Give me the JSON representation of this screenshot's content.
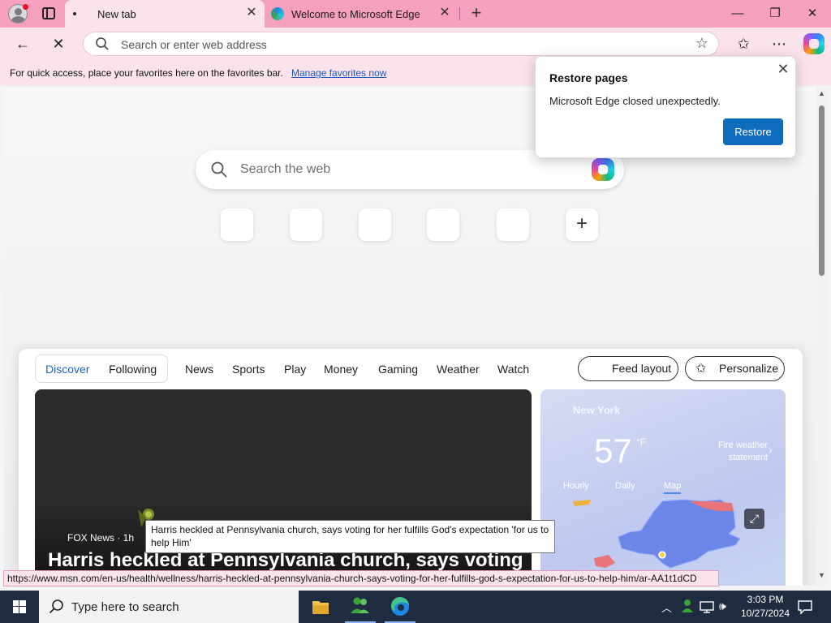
{
  "browser": {
    "tabs": [
      {
        "title": "New tab",
        "active": true
      },
      {
        "title": "Welcome to Microsoft Edge",
        "active": false
      }
    ],
    "address_placeholder": "Search or enter web address",
    "favorites_bar": {
      "message": "For quick access, place your favorites here on the favorites bar.",
      "link": "Manage favorites now"
    },
    "window_controls": {
      "minimize": "—",
      "restore": "❐",
      "close": "✕"
    }
  },
  "ntp": {
    "search_placeholder": "Search the web",
    "quick_links_count": 5,
    "add_link": "+"
  },
  "feed": {
    "pivots": {
      "discover": "Discover",
      "following": "Following"
    },
    "nav": [
      "News",
      "Sports",
      "Play",
      "Money",
      "Gaming",
      "Weather",
      "Watch"
    ],
    "feed_layout": "Feed layout",
    "personalize": "Personalize",
    "hero": {
      "source": "FOX News · 1h",
      "headline": "Harris heckled at Pennsylvania church, says voting"
    },
    "weather": {
      "city": "New York",
      "temp": "57",
      "unit": "°F",
      "alert": "Fire weather statement",
      "tabs": [
        "Hourly",
        "Daily",
        "Map"
      ],
      "selected_tab": "Map"
    }
  },
  "dialog": {
    "title": "Restore pages",
    "message": "Microsoft Edge closed unexpectedly.",
    "button": "Restore"
  },
  "tooltip": "Harris heckled at Pennsylvania church, says voting for her fulfills God's expectation 'for us to help Him'",
  "status_url": "https://www.msn.com/en-us/health/wellness/harris-heckled-at-pennsylvania-church-says-voting-for-her-fulfills-god-s-expectation-for-us-to-help-him/ar-AA1t1dCD",
  "taskbar": {
    "search_placeholder": "Type here to search",
    "time": "3:03 PM",
    "date": "10/27/2024"
  },
  "colors": {
    "titlebar": "#f6a0c0",
    "toolbar": "#fbe3ec",
    "accent": "#0f6cbd",
    "taskbar": "#1f2b3e"
  }
}
